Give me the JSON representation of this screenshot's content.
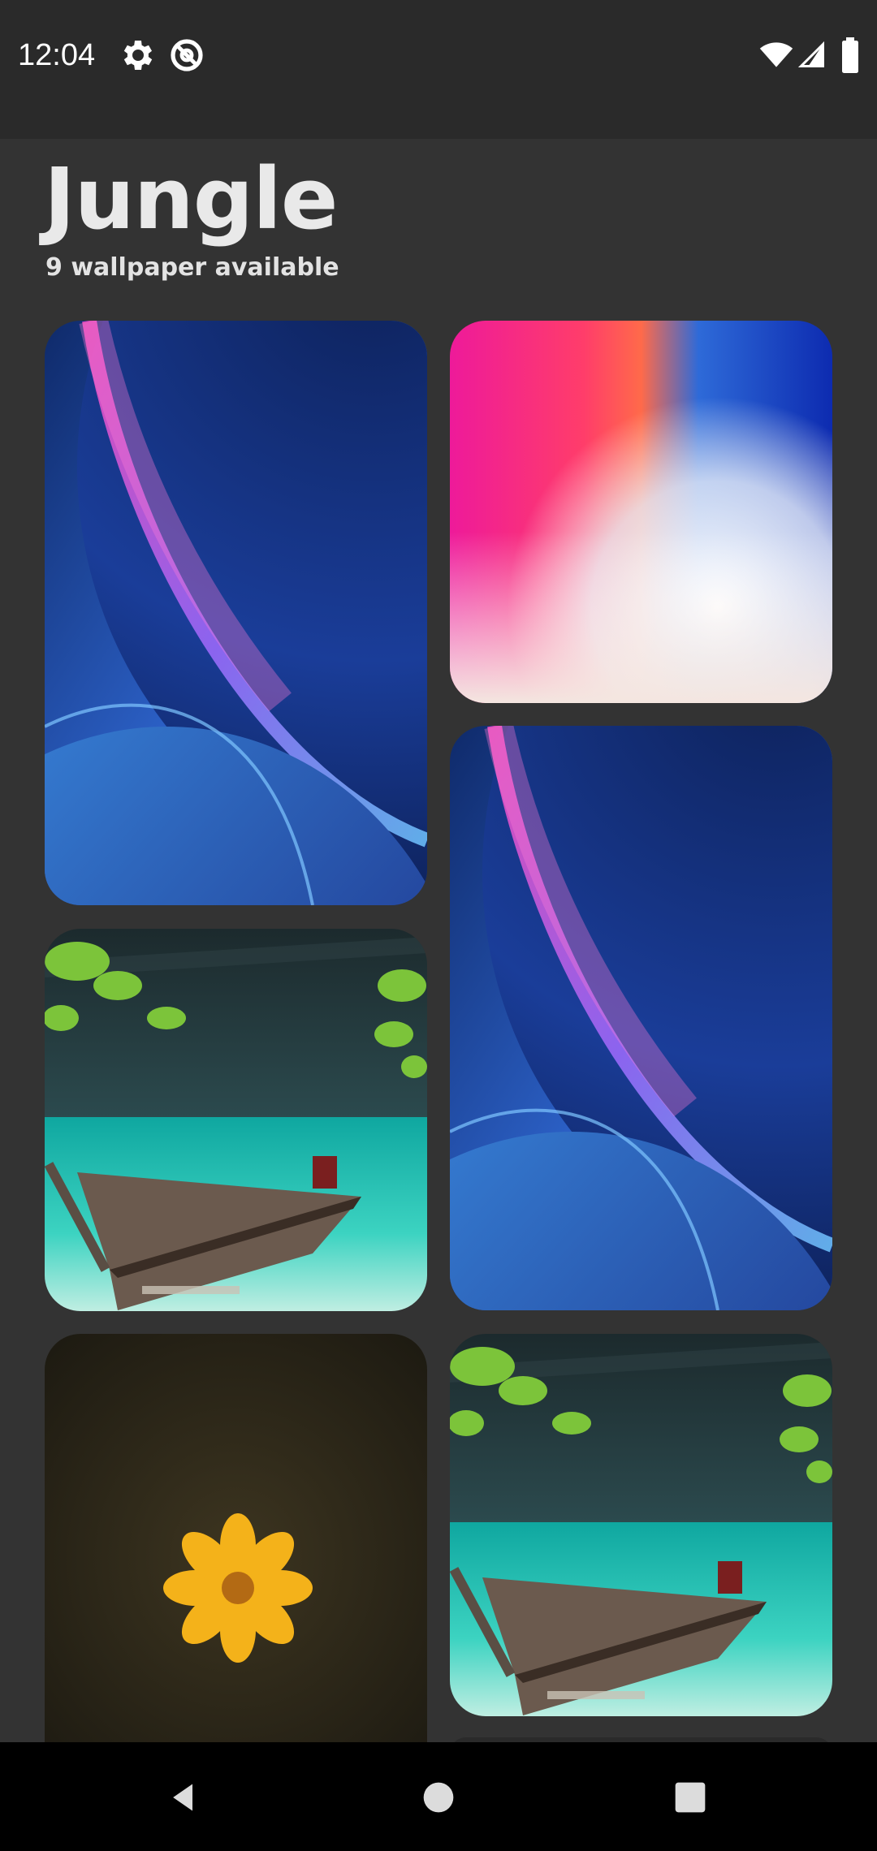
{
  "status_bar": {
    "time": "12:04",
    "left_icons": [
      "settings-gear-icon",
      "at-sign-icon"
    ],
    "right_icons": [
      "wifi-icon",
      "cellular-signal-icon",
      "battery-icon"
    ]
  },
  "header": {
    "title": "Jungle",
    "subtitle": "9 wallpaper available"
  },
  "wallpapers": [
    {
      "id": 1,
      "theme": "blue-purple bubble"
    },
    {
      "id": 2,
      "theme": "pink-blue gradient"
    },
    {
      "id": 3,
      "theme": "blue-purple bubble"
    },
    {
      "id": 4,
      "theme": "boat on turquoise water"
    },
    {
      "id": 5,
      "theme": "yellow flower on dark background"
    },
    {
      "id": 6,
      "theme": "boat on turquoise water"
    }
  ],
  "nav_bar": {
    "icons": [
      "back-icon",
      "home-icon",
      "recents-icon"
    ]
  },
  "colors": {
    "background": "#333333",
    "status_bar": "#2a2a2a",
    "nav_bar": "#000000",
    "text": "#e9e9e9"
  }
}
